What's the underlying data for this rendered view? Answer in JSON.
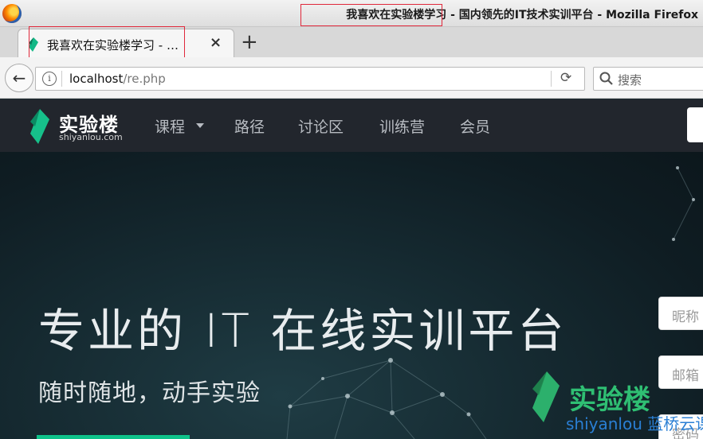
{
  "window": {
    "title": "我喜欢在实验楼学习 - 国内领先的IT技术实训平台 - Mozilla Firefox"
  },
  "tabs": [
    {
      "title": "我喜欢在实验楼学习 - …",
      "close_glyph": "×"
    }
  ],
  "new_tab_glyph": "+",
  "navbar": {
    "back_glyph": "←",
    "info_glyph": "i",
    "url_host": "localhost",
    "url_path": "/re.php",
    "reload_glyph": "⟳",
    "search_placeholder": "搜索"
  },
  "site": {
    "logo_name": "实验楼",
    "logo_domain": "shiyanlou.com",
    "nav": [
      "课程",
      "路径",
      "讨论区",
      "训练营",
      "会员"
    ],
    "brand_color": "#0fc28a"
  },
  "hero": {
    "title": "专业的 IT 在线实训平台",
    "subtitle": "随时随地，动手实验",
    "form_placeholders": [
      "昵称",
      "邮箱",
      "密码"
    ]
  },
  "watermark": {
    "name": "实验楼",
    "sub": "shiyanlou 蓝桥云课"
  },
  "icons": {
    "firefox": "firefox-logo-icon",
    "favicon": "shiyanlou-favicon-icon",
    "search": "search-icon",
    "reload": "reload-icon",
    "info": "info-icon"
  }
}
